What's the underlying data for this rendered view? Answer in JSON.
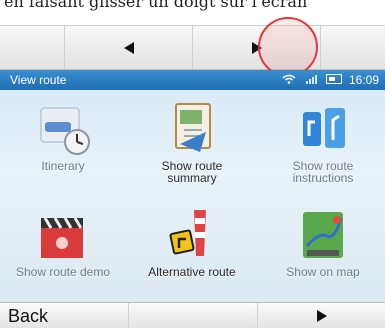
{
  "caption": {
    "text": "en faisant glisser un doigt sur l'écran"
  },
  "top_nav": {
    "prev_icon": "triangle-left-icon",
    "next_icon": "triangle-right-icon"
  },
  "status": {
    "title": "View route",
    "time": "16:09"
  },
  "tiles": [
    {
      "label": "Itinerary",
      "icon": "itinerary-clock-icon"
    },
    {
      "label": "Show route summary",
      "icon": "route-summary-icon"
    },
    {
      "label": "Show route instructions",
      "icon": "route-instructions-icon"
    },
    {
      "label": "Show route demo",
      "icon": "clapperboard-demo-icon"
    },
    {
      "label": "Alternative route",
      "icon": "roadblock-alternative-icon"
    },
    {
      "label": "Show on map",
      "icon": "map-icon"
    }
  ],
  "bottom_bar": {
    "back_label": "Back",
    "next_icon": "triangle-right-icon"
  },
  "colors": {
    "status_bar": "#2a7fc3",
    "highlight": "#e23a3a"
  }
}
